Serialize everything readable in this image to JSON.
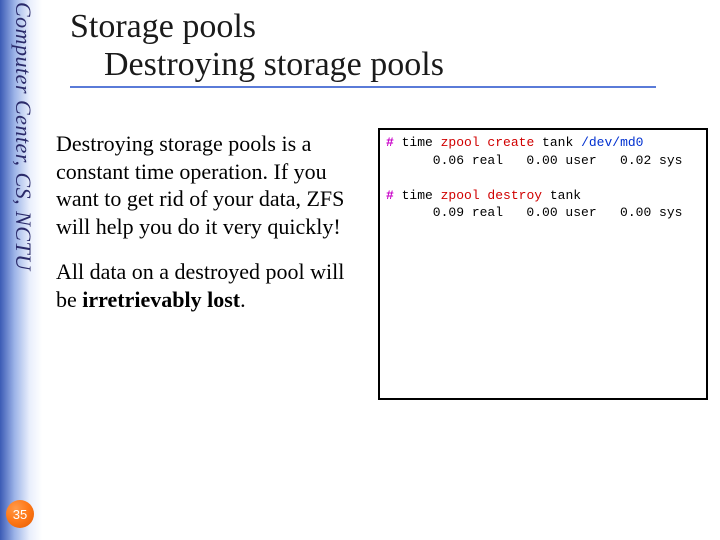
{
  "sidebar": {
    "org_text": "Computer Center, CS, NCTU"
  },
  "page_number": "35",
  "title": {
    "line1": "Storage pools",
    "line2": "Destroying storage pools"
  },
  "body": {
    "p1": "Destroying storage pools is a constant time operation.  If you want to get rid of your data, ZFS will help you do it very quickly!",
    "p2_a": "All data on a destroyed pool will be ",
    "p2_b": "irretrievably lost",
    "p2_c": "."
  },
  "terminal": {
    "l1a": "#",
    "l1b": " time ",
    "l1c": "zpool create",
    "l1d": " tank ",
    "l1e": "/dev/md0",
    "l2": "      0.06 real   0.00 user   0.02 sys",
    "l3": "",
    "l4a": "#",
    "l4b": " time ",
    "l4c": "zpool destroy",
    "l4d": " tank",
    "l5": "      0.09 real   0.00 user   0.00 sys"
  }
}
